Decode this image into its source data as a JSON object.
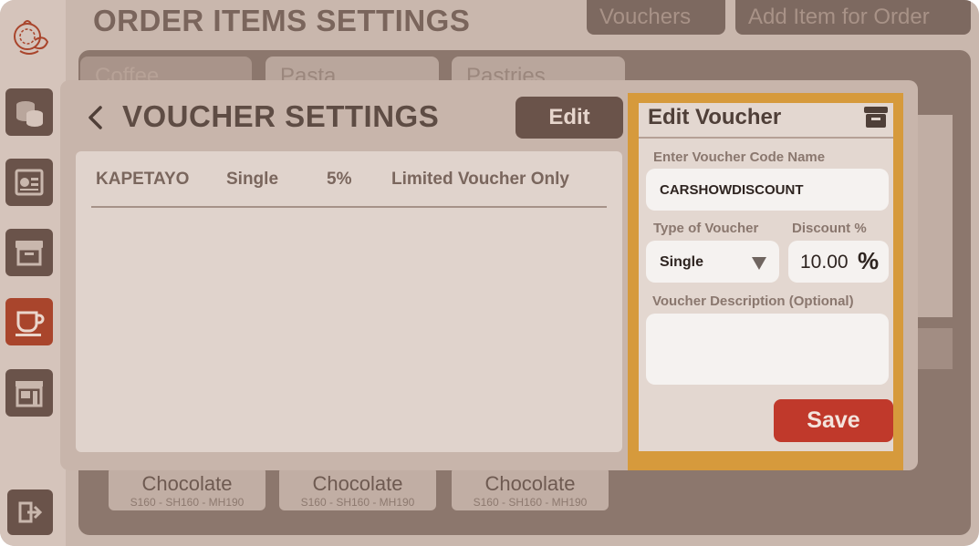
{
  "page": {
    "title": "ORDER ITEMS SETTINGS"
  },
  "header": {
    "vouchers_label": "Vouchers",
    "add_item_label": "Add Item for Order"
  },
  "categories": [
    "Coffee",
    "Pasta",
    "Pastries"
  ],
  "background_items": [
    {
      "name": "Chocolate",
      "prices": "S160 - SH160 - MH190"
    },
    {
      "name": "Chocolate",
      "prices": "S160 - SH160 - MH190"
    },
    {
      "name": "Chocolate",
      "prices": "S160 - SH160 - MH190"
    }
  ],
  "sidebar": {
    "items": [
      {
        "icon": "coins-icon"
      },
      {
        "icon": "invoice-icon"
      },
      {
        "icon": "archive-icon"
      },
      {
        "icon": "coffee-cup-icon",
        "active": true
      },
      {
        "icon": "store-icon"
      }
    ],
    "logout_icon": "logout-icon"
  },
  "modal": {
    "title": "VOUCHER SETTINGS",
    "edit_label": "Edit",
    "vouchers": [
      {
        "code": "KAPETAYO",
        "type": "Single",
        "discount": "5%",
        "description": "Limited Voucher Only"
      }
    ]
  },
  "edit_voucher": {
    "title": "Edit Voucher",
    "code_label": "Enter Voucher Code Name",
    "code_value": "CARSHOWDISCOUNT",
    "type_label": "Type of Voucher",
    "type_value": "Single",
    "discount_label": "Discount %",
    "discount_value": "10.00",
    "discount_unit": "%",
    "description_label": "Voucher Description (Optional)",
    "description_value": "",
    "save_label": "Save"
  },
  "colors": {
    "accent": "#c0392b",
    "highlight_border": "#d69a3c",
    "brown": "#6a534a"
  }
}
